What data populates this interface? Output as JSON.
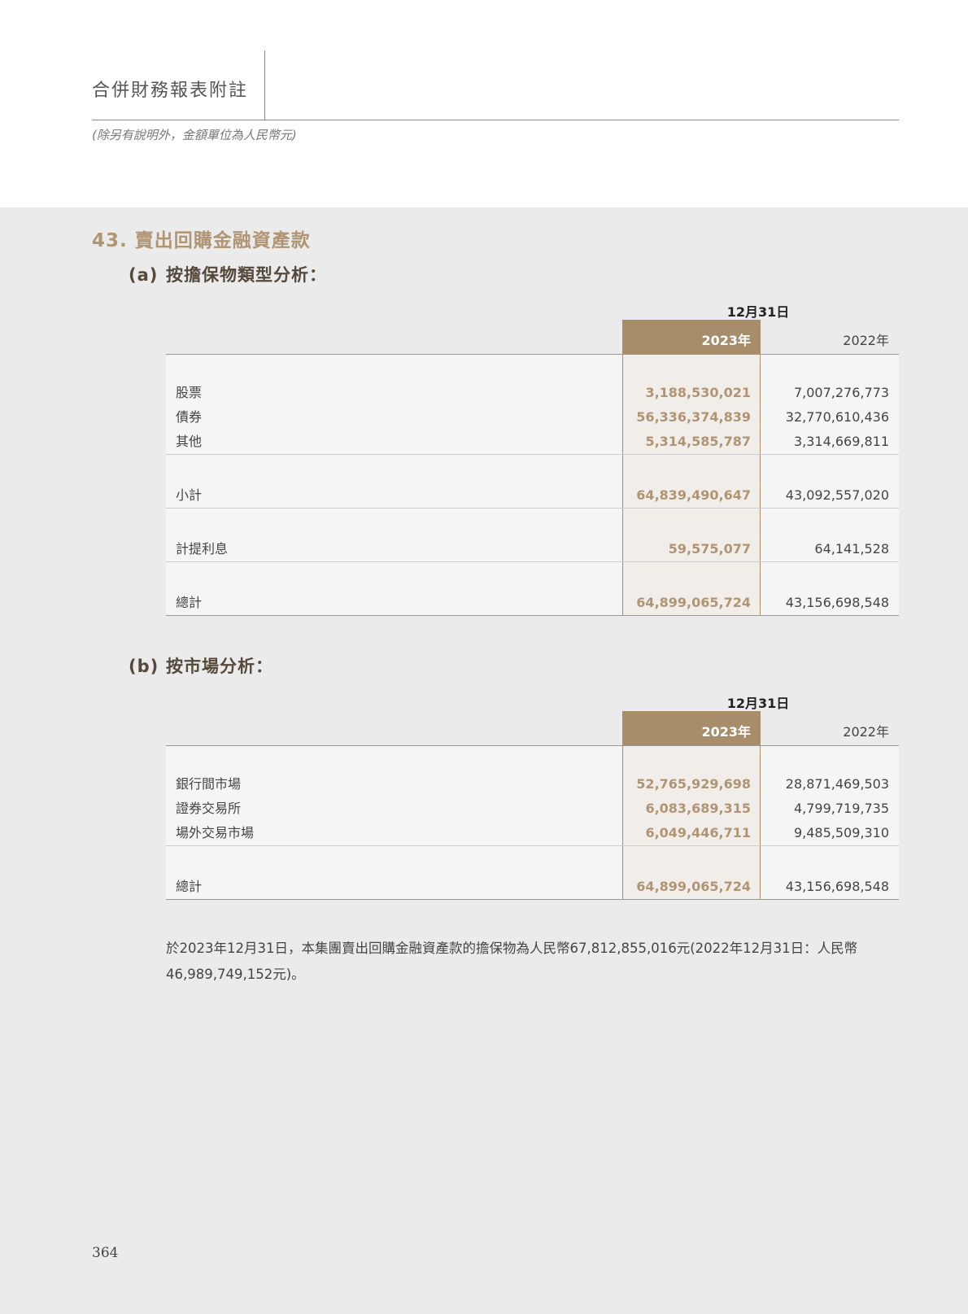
{
  "header": {
    "title": "合併財務報表附註",
    "subtitle": "(除另有說明外，金額單位為人民幣元)"
  },
  "section": {
    "title": "43. 賣出回購金融資產款"
  },
  "table_a": {
    "label": "(a)",
    "title": "按擔保物類型分析：",
    "date_header": "12月31日",
    "col_2023": "2023年",
    "col_2022": "2022年",
    "groups": [
      [
        {
          "label": "股票",
          "v2023": "3,188,530,021",
          "v2022": "7,007,276,773"
        },
        {
          "label": "債券",
          "v2023": "56,336,374,839",
          "v2022": "32,770,610,436"
        },
        {
          "label": "其他",
          "v2023": "5,314,585,787",
          "v2022": "3,314,669,811"
        }
      ],
      [
        {
          "label": "小計",
          "v2023": "64,839,490,647",
          "v2022": "43,092,557,020"
        }
      ],
      [
        {
          "label": "計提利息",
          "v2023": "59,575,077",
          "v2022": "64,141,528"
        }
      ],
      [
        {
          "label": "總計",
          "v2023": "64,899,065,724",
          "v2022": "43,156,698,548"
        }
      ]
    ]
  },
  "table_b": {
    "label": "(b)",
    "title": "按市場分析：",
    "date_header": "12月31日",
    "col_2023": "2023年",
    "col_2022": "2022年",
    "groups": [
      [
        {
          "label": "銀行間市場",
          "v2023": "52,765,929,698",
          "v2022": "28,871,469,503"
        },
        {
          "label": "證券交易所",
          "v2023": "6,083,689,315",
          "v2022": "4,799,719,735"
        },
        {
          "label": "場外交易市場",
          "v2023": "6,049,446,711",
          "v2022": "9,485,509,310"
        }
      ],
      [
        {
          "label": "總計",
          "v2023": "64,899,065,724",
          "v2022": "43,156,698,548"
        }
      ]
    ]
  },
  "note": "於2023年12月31日，本集團賣出回購金融資產款的擔保物為人民幣67,812,855,016元(2022年12月31日：人民幣46,989,749,152元)。",
  "page_number": "364"
}
